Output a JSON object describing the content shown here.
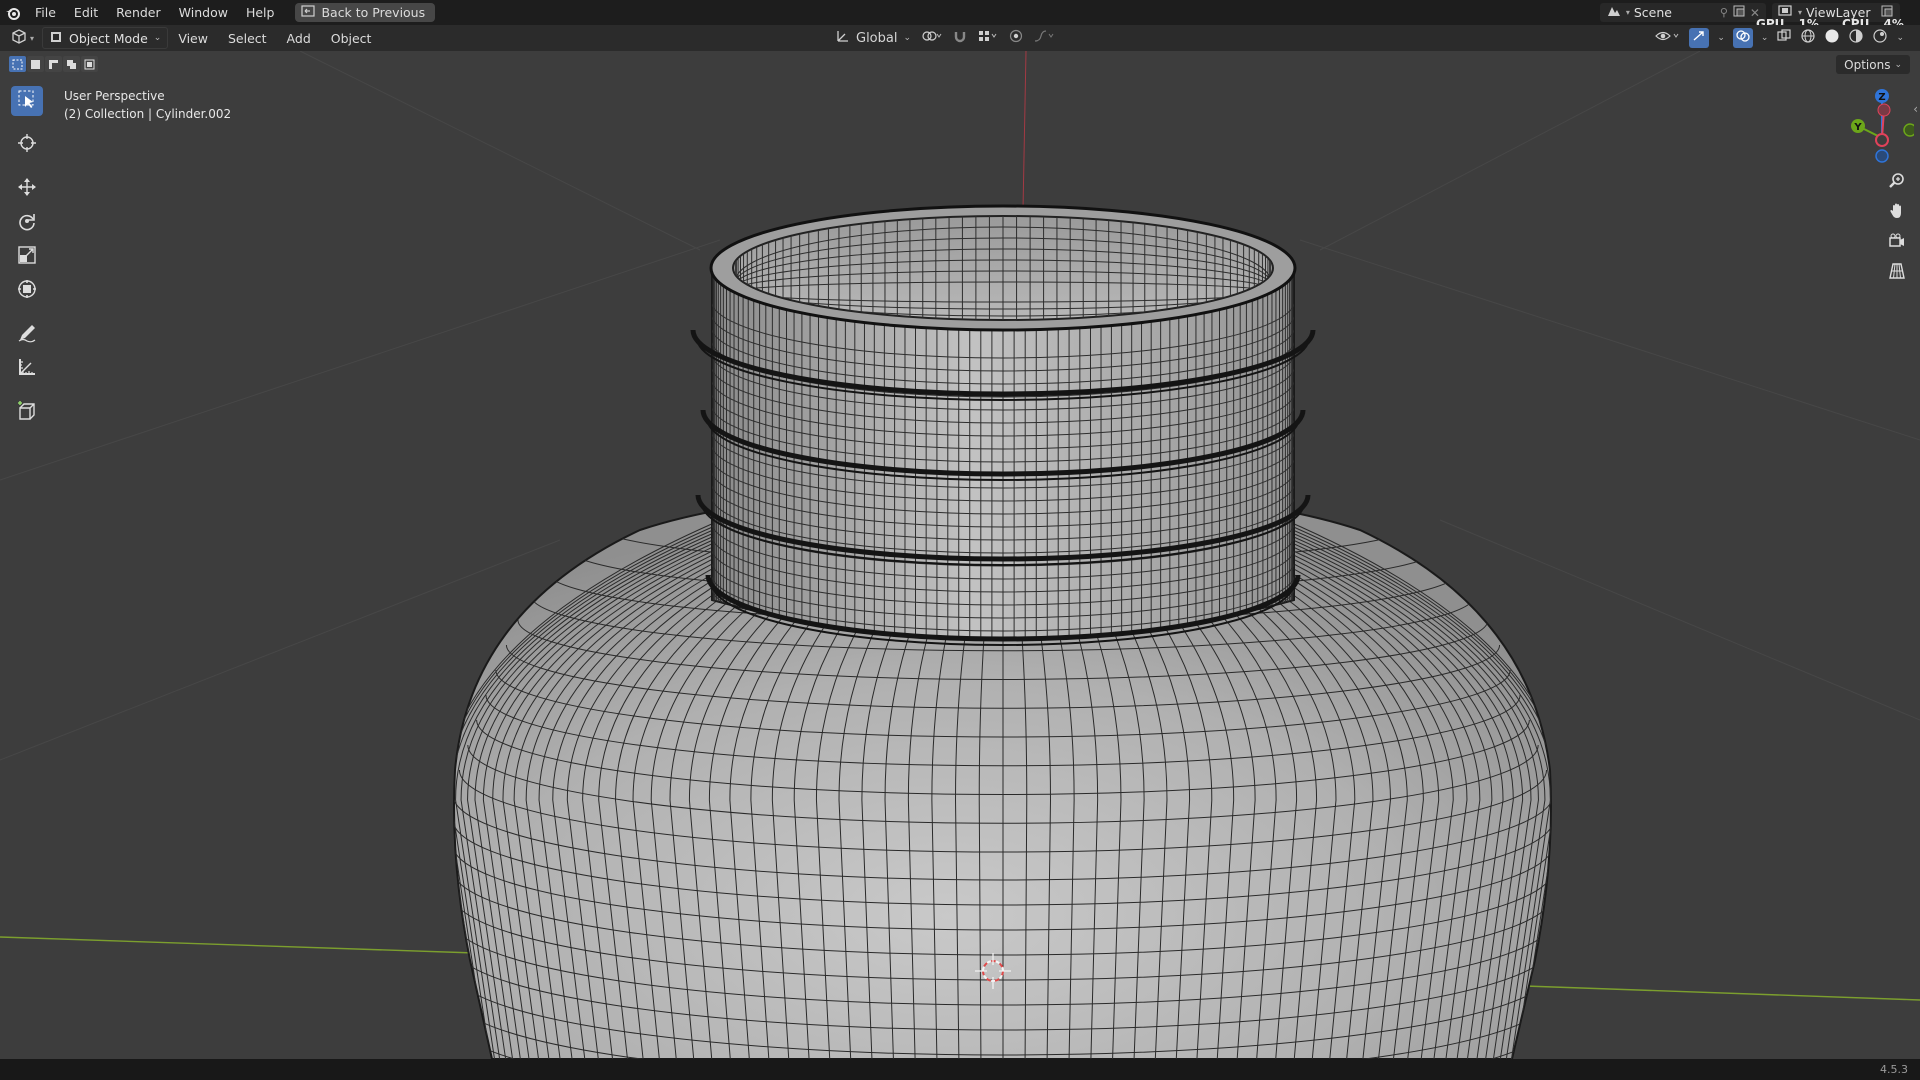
{
  "topbar": {
    "menus": [
      "File",
      "Edit",
      "Render",
      "Window",
      "Help"
    ],
    "back_button": "Back to Previous",
    "scene_name": "Scene",
    "viewlayer_name": "ViewLayer",
    "gpu_label": "GPU",
    "gpu_value": "1%",
    "cpu_label": "CPU",
    "cpu_value": "4%"
  },
  "header": {
    "mode": "Object Mode",
    "menus": [
      "View",
      "Select",
      "Add",
      "Object"
    ],
    "orientation": "Global"
  },
  "viewport": {
    "view_name": "User Perspective",
    "collection_info": "(2) Collection | Cylinder.002",
    "options_label": "Options",
    "axes": {
      "x": "X",
      "y": "Y",
      "z": "Z"
    }
  },
  "toolbar": {
    "tools": [
      "select-box",
      "cursor",
      "move",
      "rotate",
      "scale",
      "transform",
      "annotate",
      "measure",
      "add-cube"
    ],
    "active": "select-box"
  },
  "colors": {
    "accent": "#4772b3",
    "x_axis": "#e1425a",
    "y_axis": "#6ca61a",
    "z_axis": "#2f74d9"
  },
  "status": {
    "version": "4.5.3"
  }
}
